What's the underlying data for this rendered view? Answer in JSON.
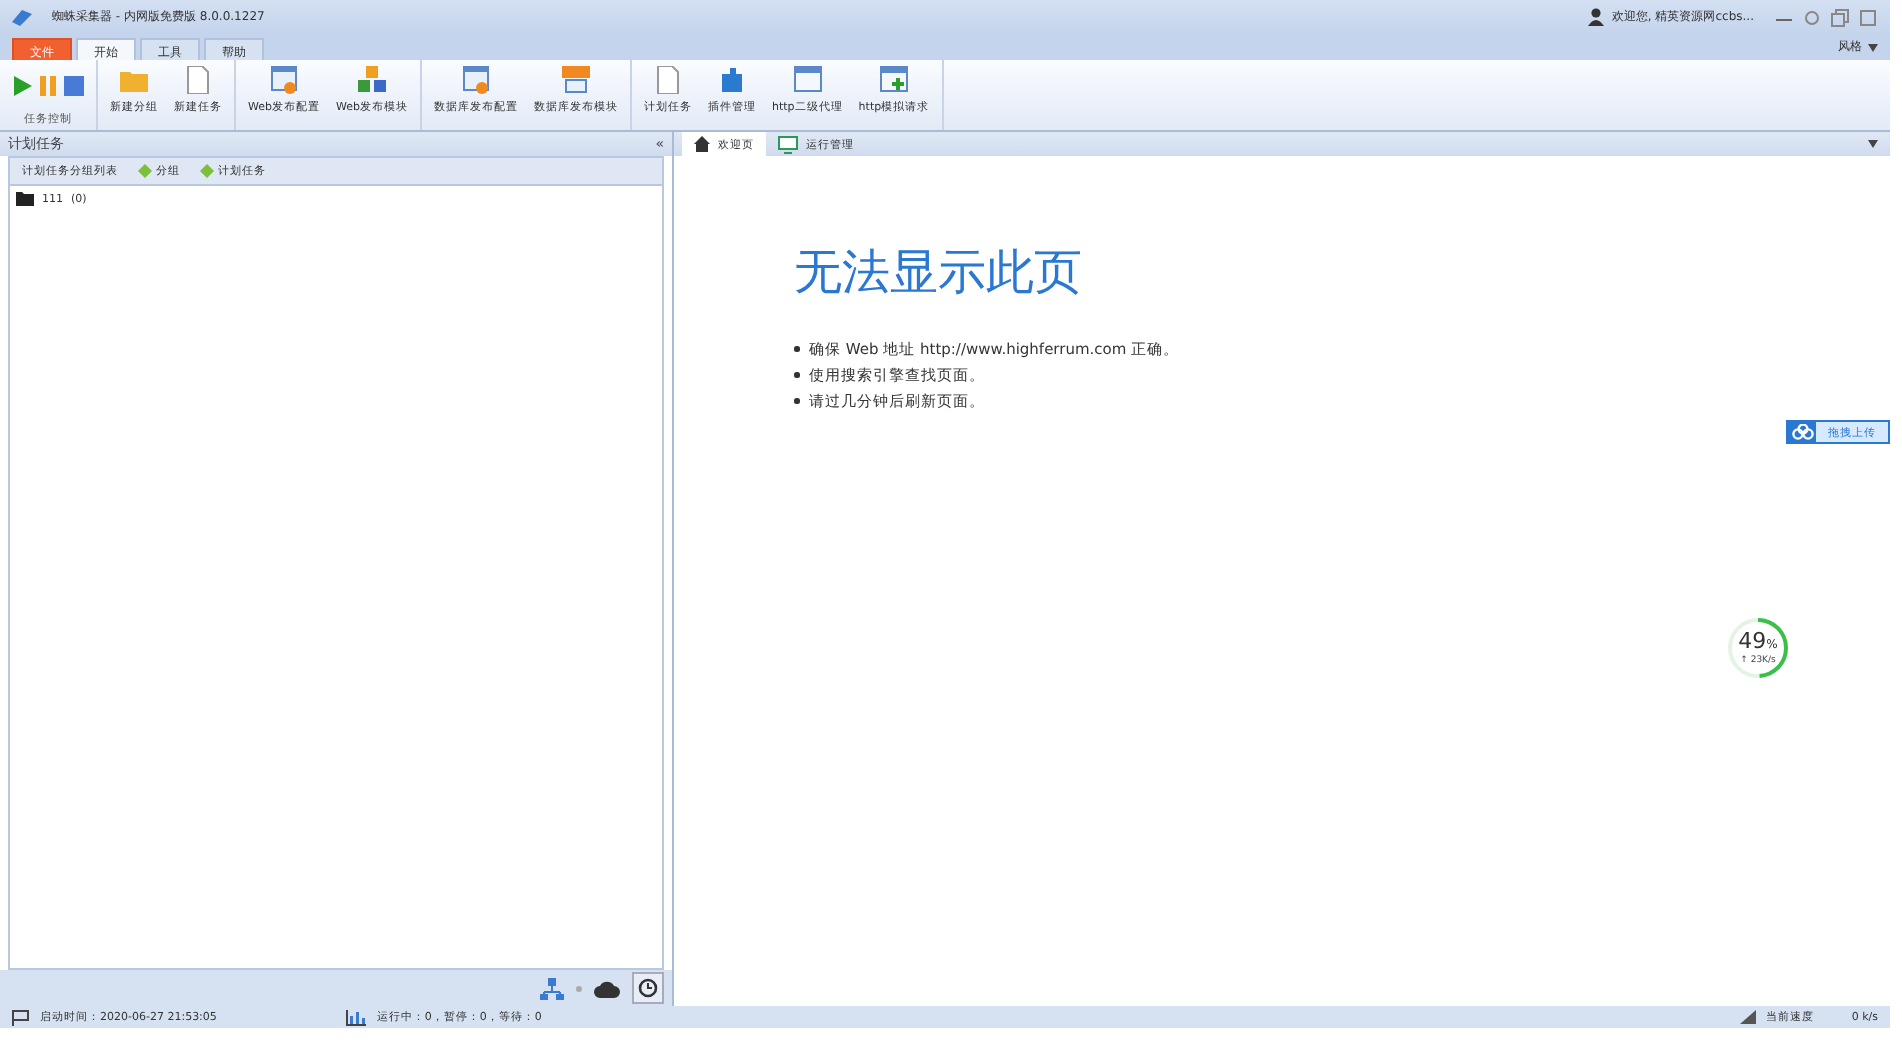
{
  "window": {
    "title": "蜘蛛采集器 - 内网版免费版 8.0.0.1227",
    "user": "欢迎您, 精英资源网ccbs...",
    "style_menu": "风格"
  },
  "ribbon_tabs": [
    {
      "label": "文件",
      "kind": "file",
      "selected": false
    },
    {
      "label": "开始",
      "kind": "tab",
      "selected": true
    },
    {
      "label": "工具",
      "kind": "tab",
      "selected": false
    },
    {
      "label": "帮助",
      "kind": "tab",
      "selected": false
    }
  ],
  "task_control": {
    "label": "任务控制"
  },
  "ribbon_groups": [
    [
      {
        "label": "新建分组"
      },
      {
        "label": "新建任务"
      }
    ],
    [
      {
        "label": "Web发布配置"
      },
      {
        "label": "Web发布模块"
      }
    ],
    [
      {
        "label": "数据库发布配置"
      },
      {
        "label": "数据库发布模块"
      }
    ],
    [
      {
        "label": "计划任务"
      },
      {
        "label": "插件管理"
      },
      {
        "label": "http二级代理"
      },
      {
        "label": "http模拟请求"
      }
    ]
  ],
  "left_panel": {
    "title": "计划任务",
    "collapse": "«",
    "toolbar": [
      {
        "label": "计划任务分组列表",
        "kind": "text"
      },
      {
        "label": "分组",
        "kind": "add"
      },
      {
        "label": "计划任务",
        "kind": "add"
      }
    ],
    "tree": [
      {
        "label": "111",
        "count": "(0)"
      }
    ]
  },
  "doc_tabs": [
    {
      "label": "欢迎页",
      "selected": true
    },
    {
      "label": "运行管理",
      "selected": false
    }
  ],
  "page": {
    "heading": "无法显示此页",
    "bullets": [
      "确保 Web 地址 http://www.highferrum.com 正确。",
      "使用搜索引擎查找页面。",
      "请过几分钟后刷新页面。"
    ]
  },
  "upload_button": "拖拽上传",
  "speed_gauge": {
    "level": 0.49,
    "percent": "49",
    "unit": "%",
    "rate": "↑ 23K/s"
  },
  "status_bar": {
    "start_time": "启动时间：2020-06-27 21:53:05",
    "counts": "运行中：0，暂停：0，等待：0",
    "speed_label": "当前速度",
    "speed": "0 k/s"
  }
}
